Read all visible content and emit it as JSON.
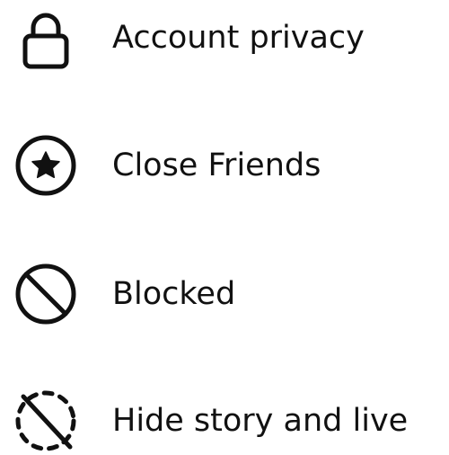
{
  "menu": {
    "items": [
      {
        "label": "Account privacy",
        "icon": "lock-icon"
      },
      {
        "label": "Close Friends",
        "icon": "star-circle-icon"
      },
      {
        "label": "Blocked",
        "icon": "blocked-icon"
      },
      {
        "label": "Hide story and live",
        "icon": "hide-story-icon"
      }
    ]
  },
  "colors": {
    "text": "#111111",
    "icon": "#111111",
    "background": "#ffffff"
  }
}
